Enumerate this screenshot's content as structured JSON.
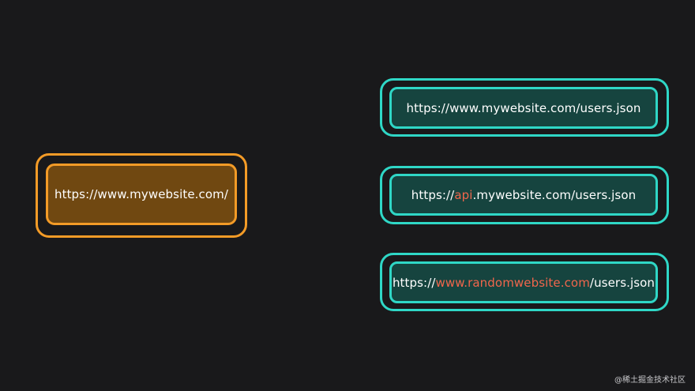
{
  "origin": {
    "url": "https://www.mywebsite.com/"
  },
  "targets": [
    {
      "prefix": "https://www.mywebsite.com/users.json",
      "highlight": "",
      "suffix": ""
    },
    {
      "prefix": "https://",
      "highlight": "api",
      "suffix": ".mywebsite.com/users.json"
    },
    {
      "prefix": "https://",
      "highlight": "www.randomwebsite.com",
      "suffix": "/users.json"
    }
  ],
  "watermark": "@稀土掘金技术社区",
  "colors": {
    "background": "#19191b",
    "origin_border": "#f39b27",
    "origin_fill": "#704811",
    "target_border": "#2fd7c6",
    "target_fill": "#16443f",
    "highlight_text": "#f0664c"
  }
}
